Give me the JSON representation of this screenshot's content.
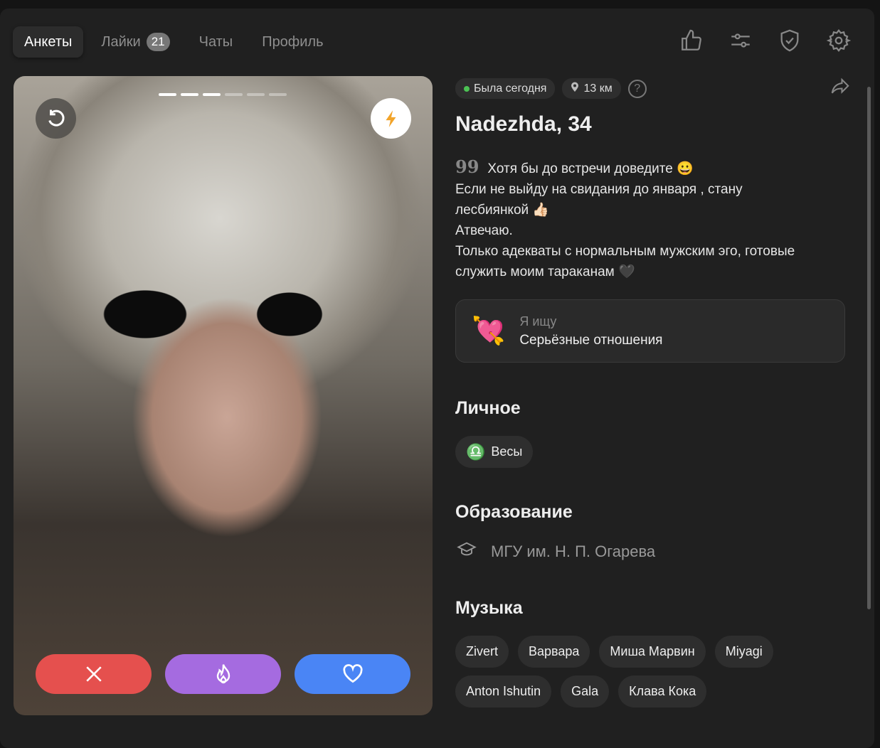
{
  "nav": {
    "tabs": [
      {
        "label": "Анкеты"
      },
      {
        "label": "Лайки",
        "badge": "21"
      },
      {
        "label": "Чаты"
      },
      {
        "label": "Профиль"
      }
    ]
  },
  "photo": {
    "total": 6,
    "current": 3
  },
  "profile": {
    "status": "Была сегодня",
    "distance": "13 км",
    "name": "Nadezhda, 34",
    "bio": [
      "Хотя бы до встречи доведите 😀",
      "Если не выйду на свидания до января , стану",
      "лесбиянкой 👍🏻",
      "Атвечаю.",
      "Только адекваты с нормальным мужским эго, готовые",
      "служить моим тараканам 🖤"
    ],
    "seeking_label": "Я ищу",
    "seeking_value": "Серьёзные отношения"
  },
  "personal": {
    "title": "Личное",
    "zodiac": "Весы"
  },
  "education": {
    "title": "Образование",
    "value": "МГУ им. Н. П. Огарева"
  },
  "music": {
    "title": "Музыка",
    "artists": [
      "Zivert",
      "Варвара",
      "Миша Марвин",
      "Miyagi",
      "Anton Ishutin",
      "Gala",
      "Клава Кока"
    ]
  },
  "colors": {
    "dislike": "#e5504e",
    "superlike": "#a56be0",
    "like": "#4a85f5",
    "accent": "#f2a42a"
  }
}
